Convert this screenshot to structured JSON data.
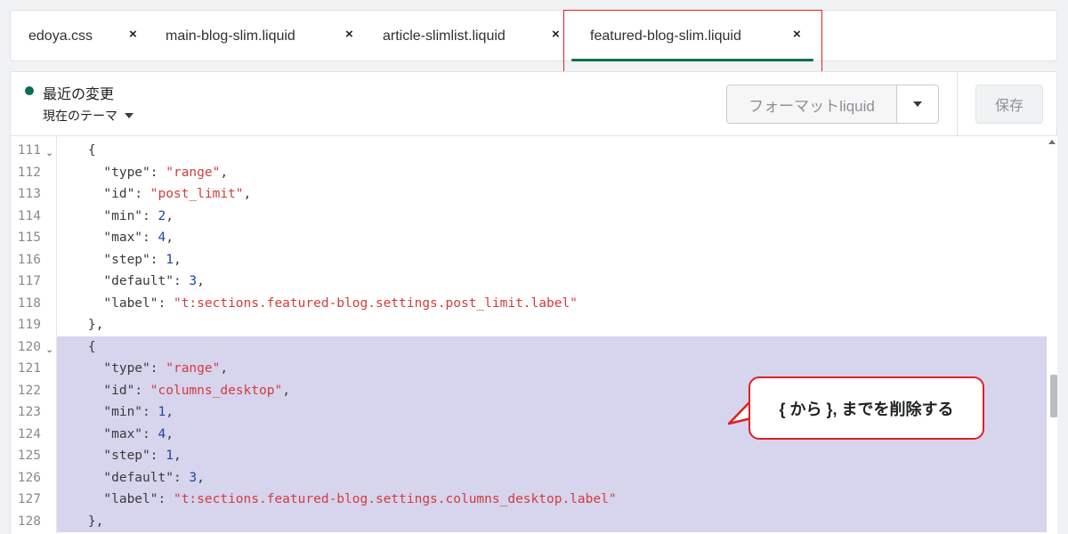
{
  "tabs": [
    {
      "label": "edoya.css",
      "close": "×"
    },
    {
      "label": "main-blog-slim.liquid",
      "close": "×"
    },
    {
      "label": "article-slimlist.liquid",
      "close": "×"
    },
    {
      "label": "featured-blog-slim.liquid",
      "close": "×",
      "active": true
    }
  ],
  "header": {
    "status_title": "最近の変更",
    "theme_label": "現在のテーマ",
    "format_label": "フォーマットliquid",
    "save_label": "保存"
  },
  "code": {
    "lines": [
      {
        "n": "111",
        "fold": true,
        "sel": false,
        "parts": [
          [
            "p",
            "    {"
          ]
        ]
      },
      {
        "n": "112",
        "fold": false,
        "sel": false,
        "parts": [
          [
            "k",
            "      \"type\""
          ],
          [
            "p",
            ": "
          ],
          [
            "s",
            "\"range\""
          ],
          [
            "p",
            ","
          ]
        ]
      },
      {
        "n": "113",
        "fold": false,
        "sel": false,
        "parts": [
          [
            "k",
            "      \"id\""
          ],
          [
            "p",
            ": "
          ],
          [
            "s",
            "\"post_limit\""
          ],
          [
            "p",
            ","
          ]
        ]
      },
      {
        "n": "114",
        "fold": false,
        "sel": false,
        "parts": [
          [
            "k",
            "      \"min\""
          ],
          [
            "p",
            ": "
          ],
          [
            "n",
            "2"
          ],
          [
            "p",
            ","
          ]
        ]
      },
      {
        "n": "115",
        "fold": false,
        "sel": false,
        "parts": [
          [
            "k",
            "      \"max\""
          ],
          [
            "p",
            ": "
          ],
          [
            "n",
            "4"
          ],
          [
            "p",
            ","
          ]
        ]
      },
      {
        "n": "116",
        "fold": false,
        "sel": false,
        "parts": [
          [
            "k",
            "      \"step\""
          ],
          [
            "p",
            ": "
          ],
          [
            "n",
            "1"
          ],
          [
            "p",
            ","
          ]
        ]
      },
      {
        "n": "117",
        "fold": false,
        "sel": false,
        "parts": [
          [
            "k",
            "      \"default\""
          ],
          [
            "p",
            ": "
          ],
          [
            "n",
            "3"
          ],
          [
            "p",
            ","
          ]
        ]
      },
      {
        "n": "118",
        "fold": false,
        "sel": false,
        "parts": [
          [
            "k",
            "      \"label\""
          ],
          [
            "p",
            ": "
          ],
          [
            "s",
            "\"t:sections.featured-blog.settings.post_limit.label\""
          ]
        ]
      },
      {
        "n": "119",
        "fold": false,
        "sel": false,
        "parts": [
          [
            "p",
            "    },"
          ]
        ]
      },
      {
        "n": "120",
        "fold": true,
        "sel": true,
        "parts": [
          [
            "p",
            "    {"
          ]
        ]
      },
      {
        "n": "121",
        "fold": false,
        "sel": true,
        "parts": [
          [
            "k",
            "      \"type\""
          ],
          [
            "p",
            ": "
          ],
          [
            "s",
            "\"range\""
          ],
          [
            "p",
            ","
          ]
        ]
      },
      {
        "n": "122",
        "fold": false,
        "sel": true,
        "parts": [
          [
            "k",
            "      \"id\""
          ],
          [
            "p",
            ": "
          ],
          [
            "s",
            "\"columns_desktop\""
          ],
          [
            "p",
            ","
          ]
        ]
      },
      {
        "n": "123",
        "fold": false,
        "sel": true,
        "parts": [
          [
            "k",
            "      \"min\""
          ],
          [
            "p",
            ": "
          ],
          [
            "n",
            "1"
          ],
          [
            "p",
            ","
          ]
        ]
      },
      {
        "n": "124",
        "fold": false,
        "sel": true,
        "parts": [
          [
            "k",
            "      \"max\""
          ],
          [
            "p",
            ": "
          ],
          [
            "n",
            "4"
          ],
          [
            "p",
            ","
          ]
        ]
      },
      {
        "n": "125",
        "fold": false,
        "sel": true,
        "parts": [
          [
            "k",
            "      \"step\""
          ],
          [
            "p",
            ": "
          ],
          [
            "n",
            "1"
          ],
          [
            "p",
            ","
          ]
        ]
      },
      {
        "n": "126",
        "fold": false,
        "sel": true,
        "parts": [
          [
            "k",
            "      \"default\""
          ],
          [
            "p",
            ": "
          ],
          [
            "n",
            "3"
          ],
          [
            "p",
            ","
          ]
        ]
      },
      {
        "n": "127",
        "fold": false,
        "sel": true,
        "parts": [
          [
            "k",
            "      \"label\""
          ],
          [
            "p",
            ": "
          ],
          [
            "s",
            "\"t:sections.featured-blog.settings.columns_desktop.label\""
          ]
        ]
      },
      {
        "n": "128",
        "fold": false,
        "sel": true,
        "parts": [
          [
            "p",
            "    },"
          ]
        ]
      }
    ]
  },
  "callout": {
    "text": "{ から }, までを削除する"
  },
  "colors": {
    "accent": "#0c6e54",
    "selection": "#d7d4ee",
    "highlight_border": "#e02020",
    "string": "#d23c3c",
    "number": "#1c44a8"
  }
}
